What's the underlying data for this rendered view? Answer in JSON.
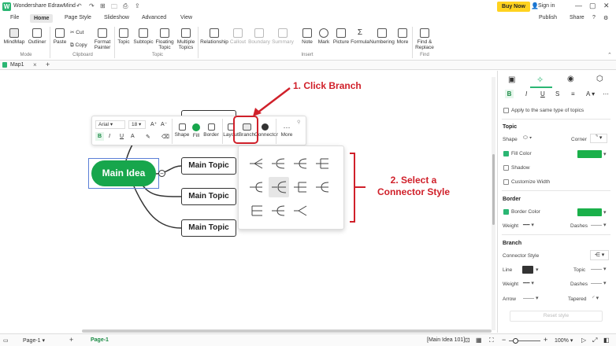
{
  "app": {
    "logo": "W",
    "name": "Wondershare EdrawMind"
  },
  "titlebar": {
    "buy_now": "Buy Now",
    "sign_in": "Sign in"
  },
  "menu": {
    "file": "File",
    "home": "Home",
    "page_style": "Page Style",
    "slideshow": "Slideshow",
    "advanced": "Advanced",
    "view": "View",
    "publish": "Publish",
    "share": "Share"
  },
  "ribbon": {
    "mindmap": "MindMap",
    "outliner": "Outliner",
    "paste": "Paste",
    "cut": "Cut",
    "copy": "Copy",
    "format_painter": "Format Painter",
    "topic": "Topic",
    "subtopic": "Subtopic",
    "floating_topic": "Floating Topic",
    "multiple_topics": "Multiple Topics",
    "relationship": "Relationship",
    "callout": "Callout",
    "boundary": "Boundary",
    "summary": "Summary",
    "note": "Note",
    "mark": "Mark",
    "picture": "Picture",
    "formula": "Formula",
    "numbering": "Numbering",
    "more": "More",
    "find_replace": "Find & Replace",
    "group_mode": "Mode",
    "group_clipboard": "Clipboard",
    "group_topic": "Topic",
    "group_insert": "Insert",
    "group_find": "Find"
  },
  "tabs": {
    "doc_tab": "Map1"
  },
  "canvas": {
    "main_idea": "Main Idea",
    "topics": [
      "Main Topic",
      "Main Topic",
      "Main Topic"
    ]
  },
  "float_toolbar": {
    "font": "Arial",
    "size": "18",
    "grow": "A⁺",
    "shrink": "A⁻",
    "bold": "B",
    "italic": "I",
    "underline": "U",
    "font_color": "A",
    "shape": "Shape",
    "fill": "Fill",
    "border": "Border",
    "layout": "Layout",
    "branch": "Branch",
    "connector": "Connector",
    "more": "More"
  },
  "annotations": {
    "step1": "1. Click Branch",
    "step2": "2. Select a Connector Style"
  },
  "right_panel": {
    "apply_same": "Apply to the same type of topics",
    "topic_head": "Topic",
    "shape": "Shape",
    "corner": "Corner",
    "fill_color": "Fill Color",
    "shadow": "Shadow",
    "customize_width": "Customize Width",
    "border_head": "Border",
    "border_color": "Border Color",
    "weight": "Weight",
    "dashes": "Dashes",
    "branch_head": "Branch",
    "connector_style": "Connector Style",
    "line": "Line",
    "topic": "Topic",
    "weight2": "Weight",
    "dashes2": "Dashes",
    "arrow": "Arrow",
    "tapered": "Tapered",
    "reset_style": "Reset style",
    "green": "#1ab04a"
  },
  "statusbar": {
    "page_select": "Page-1",
    "page_tab": "Page-1",
    "selection": "[Main Idea 101]",
    "zoom": "100%"
  }
}
